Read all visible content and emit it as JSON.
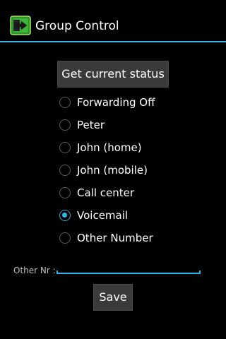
{
  "app": {
    "title": "Group Control",
    "icon": "forward-arrow-icon",
    "accent_color": "#33b5e5"
  },
  "status_button": {
    "label": "Get current status"
  },
  "forwarding_options": [
    {
      "label": "Forwarding Off",
      "checked": false
    },
    {
      "label": "Peter",
      "checked": false
    },
    {
      "label": "John (home)",
      "checked": false
    },
    {
      "label": "John (mobile)",
      "checked": false
    },
    {
      "label": "Call center",
      "checked": false
    },
    {
      "label": "Voicemail",
      "checked": true
    },
    {
      "label": "Other Number",
      "checked": false
    }
  ],
  "other_number": {
    "label": "Other Nr :",
    "value": "",
    "placeholder": ""
  },
  "save_button": {
    "label": "Save"
  }
}
